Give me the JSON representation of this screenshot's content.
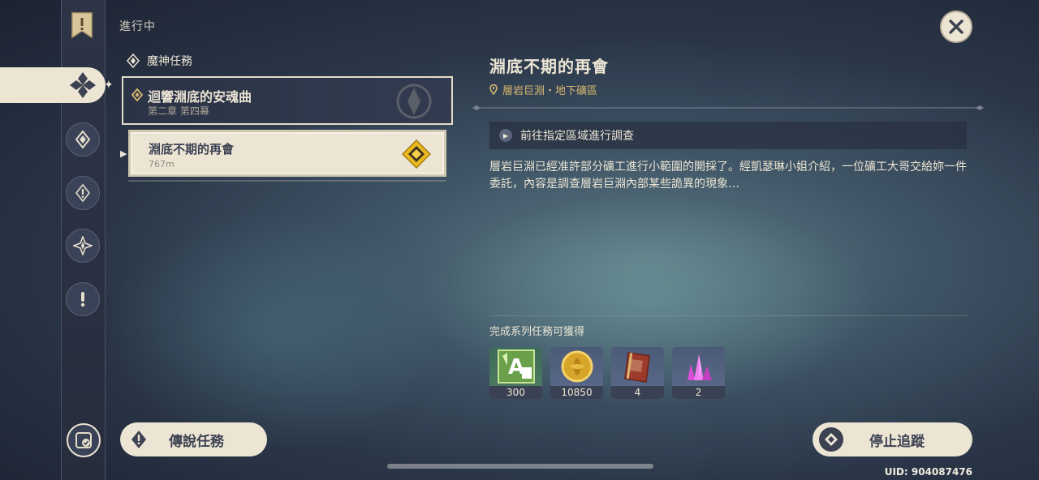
{
  "header": {
    "section_title": "進行中",
    "category": "魔神任務"
  },
  "quest_group": {
    "name": "迴響淵底的安魂曲",
    "chapter": "第二章 第四幕"
  },
  "quest_item": {
    "name": "淵底不期的再會",
    "distance": "767m"
  },
  "detail": {
    "title": "淵底不期的再會",
    "location": "層岩巨淵・地下礦區",
    "objective": "前往指定區域進行調查",
    "description": "層岩巨淵已經准許部分礦工進行小範圍的開採了。經凱瑟琳小姐介紹，一位礦工大哥交給妳一件委託，內容是調查層岩巨淵內部某些詭異的現象…",
    "rewards_title": "完成系列任務可獲得",
    "rewards": [
      {
        "icon": "adventure-exp-icon",
        "count": "300"
      },
      {
        "icon": "mora-coin-icon",
        "count": "10850"
      },
      {
        "icon": "heros-wit-book-icon",
        "count": "4"
      },
      {
        "icon": "crystal-ore-icon",
        "count": "2"
      }
    ]
  },
  "buttons": {
    "legend_quests": "傳說任務",
    "stop_tracking": "停止追蹤"
  },
  "uid": "UID: 904087476",
  "colors": {
    "panel_cream": "#ece5d4",
    "dark_text": "#3d4252",
    "location_gold": "#d8b870",
    "quest_diamond": "#e8b820"
  }
}
